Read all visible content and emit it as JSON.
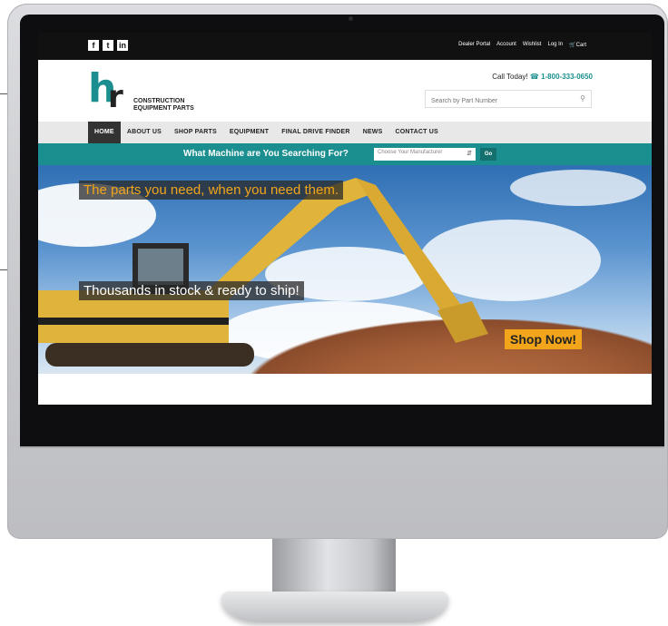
{
  "topbar": {
    "social": [
      "f",
      "t",
      "in"
    ],
    "links": [
      "Dealer Portal",
      "Account",
      "Wishlist",
      "Log In",
      "Cart"
    ]
  },
  "logo": {
    "h": "h",
    "r": "r",
    "line1": "CONSTRUCTION",
    "line2": "EQUIPMENT PARTS"
  },
  "header": {
    "call_label": "Call Today!",
    "phone": "1-800-333-0650",
    "search_placeholder": "Search by Part Number"
  },
  "nav": {
    "items": [
      "HOME",
      "ABOUT US",
      "SHOP PARTS",
      "EQUIPMENT",
      "FINAL DRIVE FINDER",
      "NEWS",
      "CONTACT US"
    ]
  },
  "machine_bar": {
    "question": "What Machine are You Searching For?",
    "select_value": "Choose Your Manufacturer",
    "go_label": "Go"
  },
  "hero": {
    "tagline_1": "The parts you need, when you need them.",
    "tagline_2": "Thousands in stock & ready to ship!",
    "cta": "Shop Now!"
  },
  "colors": {
    "brand_teal": "#1b8f8f",
    "accent_orange": "#f2a51a",
    "excavator_yellow": "#e0b43a",
    "topbar": "#111111"
  }
}
